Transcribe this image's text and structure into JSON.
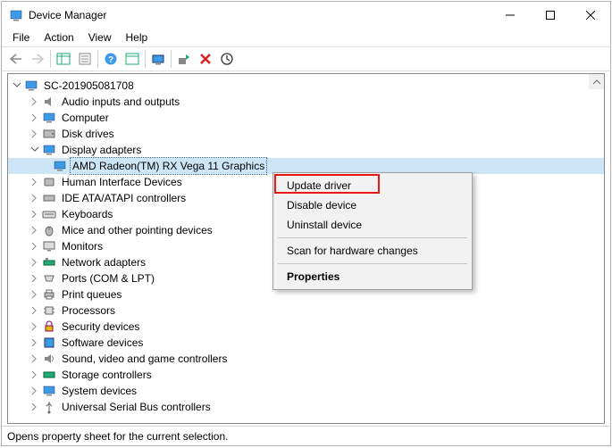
{
  "title": "Device Manager",
  "menus": {
    "file": "File",
    "action": "Action",
    "view": "View",
    "help": "Help"
  },
  "root": "SC-201905081708",
  "categories": {
    "audio": "Audio inputs and outputs",
    "computer": "Computer",
    "disk": "Disk drives",
    "display": "Display adapters",
    "hid": "Human Interface Devices",
    "ide": "IDE ATA/ATAPI controllers",
    "keyboards": "Keyboards",
    "mice": "Mice and other pointing devices",
    "monitors": "Monitors",
    "network": "Network adapters",
    "ports": "Ports (COM & LPT)",
    "printq": "Print queues",
    "cpu": "Processors",
    "security": "Security devices",
    "software": "Software devices",
    "sound": "Sound, video and game controllers",
    "storage": "Storage controllers",
    "sysdev": "System devices",
    "usb": "Universal Serial Bus controllers"
  },
  "selected_device": "AMD Radeon(TM) RX Vega 11 Graphics",
  "context_menu": {
    "update": "Update driver",
    "disable": "Disable device",
    "uninstall": "Uninstall device",
    "scan": "Scan for hardware changes",
    "properties": "Properties"
  },
  "status": "Opens property sheet for the current selection."
}
